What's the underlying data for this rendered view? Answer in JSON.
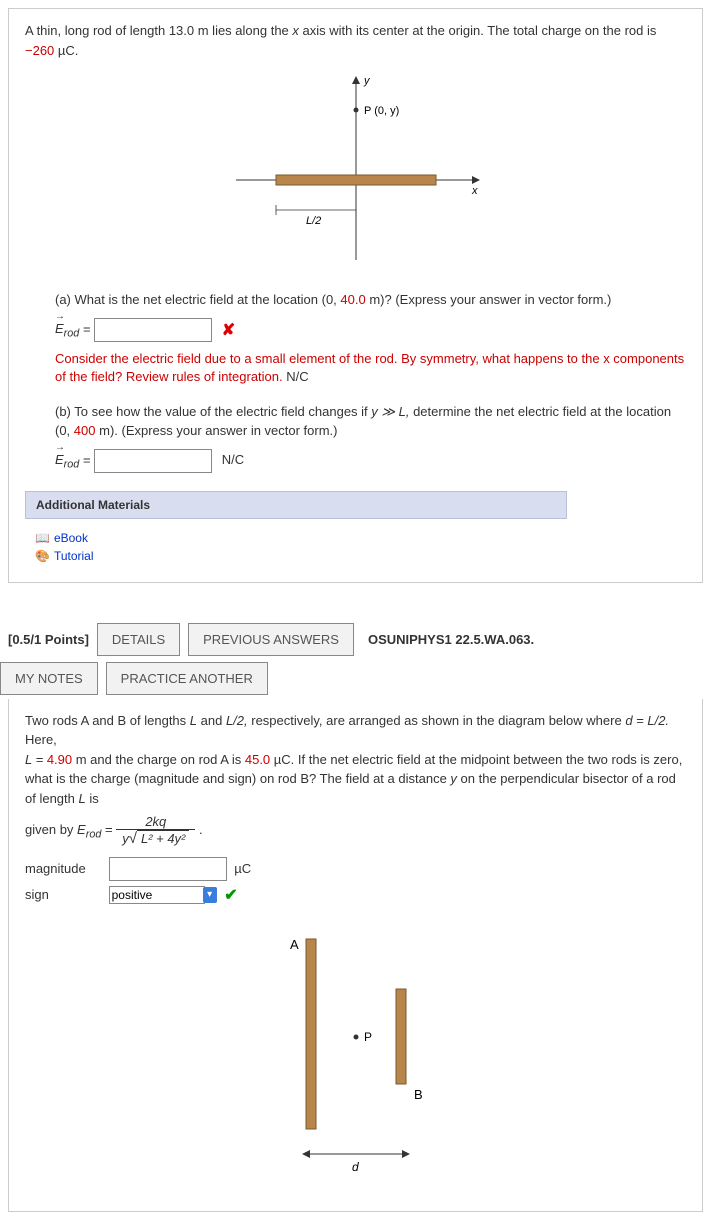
{
  "q1": {
    "intro_pre": "A thin, long rod of length 13.0 m lies along the ",
    "intro_axis": "x",
    "intro_mid": " axis with its center at the origin. The total charge on the rod is  ",
    "charge": "−260",
    "charge_unit": " µC.",
    "diagram": {
      "y": "y",
      "P": "P (0, y)",
      "x": "x",
      "Lhalf": "L/2"
    },
    "part_a_pre": "(a) What is the net electric field at the location  (0, ",
    "part_a_val": "40.0",
    "part_a_post": " m)?  (Express your answer in vector form.)",
    "erod_symbol": "E",
    "erod_sub": "rod",
    "equals": "  =  ",
    "feedback": "Consider the electric field due to a small element of the rod. By symmetry, what happens to the x components of the field? Review rules of integration.",
    "feedback_unit": " N/C",
    "part_b_pre": "(b) To see how the value of the electric field changes if  ",
    "part_b_cond": "y ≫ L,",
    "part_b_mid": "  determine the net electric field at the location (0, ",
    "part_b_val": "400",
    "part_b_post": " m). (Express your answer in vector form.)",
    "unit_b": "N/C",
    "additional_header": "Additional Materials",
    "ebook": "eBook",
    "tutorial": "Tutorial"
  },
  "q2": {
    "points": "[0.5/1 Points]",
    "details_btn": "DETAILS",
    "prev_btn": "PREVIOUS ANSWERS",
    "ref": "OSUNIPHYS1 22.5.WA.063.",
    "mynotes_btn": "MY NOTES",
    "practice_btn": "PRACTICE ANOTHER",
    "text_pre": "Two rods A and B of lengths ",
    "L": "L",
    "and": " and  ",
    "Lhalf": "L/2,",
    "text_mid1": "  respectively, are arranged as shown in the diagram below where  ",
    "d_eq": "d = L/2.",
    "text_mid2": "  Here,",
    "L_eq_pre": "L = ",
    "L_val": "4.90",
    "L_eq_post": " m  and the charge on rod A is ",
    "qa_val": "45.0",
    "qa_post": " µC. If the net electric field at the midpoint between the two rods is zero, what is the charge (magnitude and sign) on rod B? The field at a distance ",
    "y_var": "y",
    "text_mid3": " on the perpendicular bisector of a rod of length ",
    "text_post": " is",
    "given_by": "given by  ",
    "erod": "E",
    "erod_sub": "rod",
    "frac_num": "2kq",
    "frac_den_y": "y",
    "frac_den_sqrt": "L² + 4y²",
    "period": " .",
    "magnitude_label": "magnitude",
    "mag_unit": "µC",
    "sign_label": "sign",
    "sign_value": "positive",
    "diagram": {
      "A": "A",
      "B": "B",
      "P": "P",
      "d": "d"
    }
  }
}
